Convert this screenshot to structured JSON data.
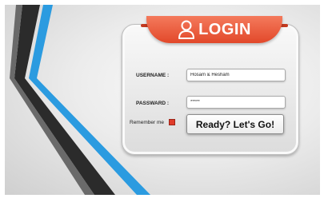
{
  "login": {
    "title": "LOGIN",
    "username_label": "USERNAME :",
    "username_value": "Hosam & Hesham",
    "password_label": "PASSWARD :",
    "password_value": "*****",
    "remember_label": "Remember me",
    "submit_label": "Ready?  Let's Go!"
  },
  "icons": {
    "header_icon": "user-icon"
  },
  "colors": {
    "header_accent": "#e65a3c",
    "stripe_blue": "#2b9be0",
    "stripe_dark": "#2a2a2a",
    "checkbox_red": "#e03c2a"
  }
}
